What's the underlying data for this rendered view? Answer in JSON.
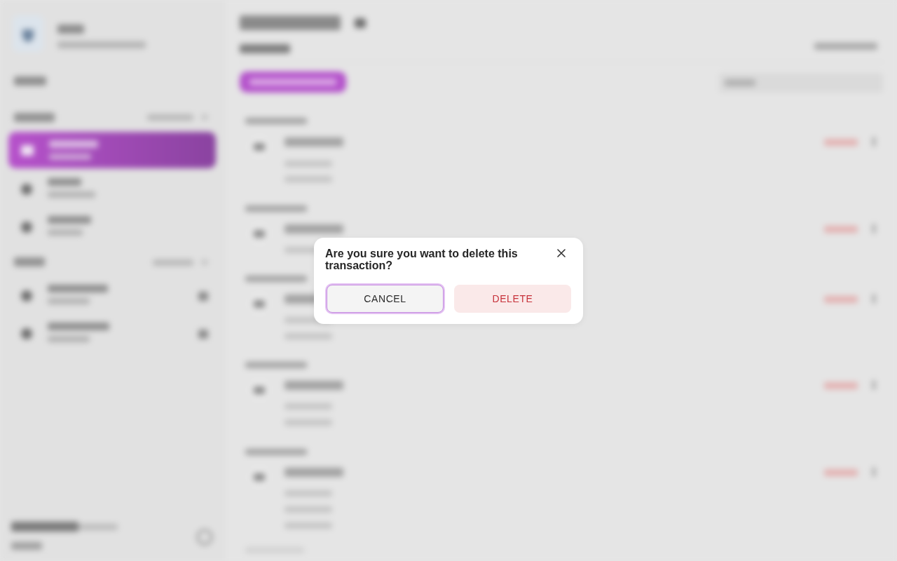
{
  "dialog": {
    "title": "Are you sure you want to delete this transaction?",
    "buttons": [
      {
        "label": "CANCEL",
        "kind": "secondary",
        "focused": true
      },
      {
        "label": "DELETE",
        "kind": "danger",
        "focused": false
      }
    ]
  }
}
